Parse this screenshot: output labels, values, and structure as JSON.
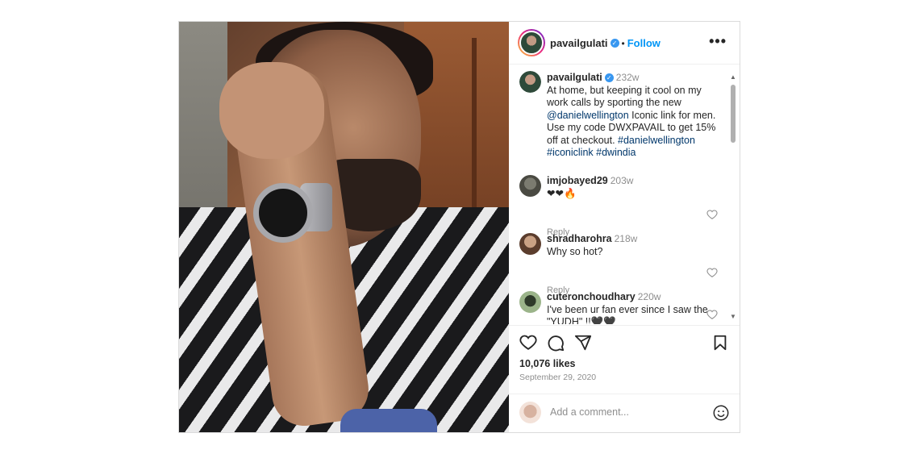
{
  "post": {
    "author": "pavailgulati",
    "follow_label": "Follow",
    "dot": "•",
    "more_label": "•••"
  },
  "caption": {
    "username": "pavailgulati",
    "time": "232w",
    "text_before": "At home, but keeping it cool on my work calls by sporting the new ",
    "mention": "@danielwellington",
    "text_after": " Iconic link for men. Use my code DWXPAVAIL to get 15% off at checkout. ",
    "hashtags": "#danielwellington #iconiclink #dwindia"
  },
  "comments": [
    {
      "username": "imjobayed29",
      "time": "203w",
      "text": "❤❤🔥",
      "reply": "Reply"
    },
    {
      "username": "shradharohra",
      "time": "218w",
      "text": "Why so hot?",
      "reply": "Reply"
    },
    {
      "username": "cuteronchoudhary",
      "time": "220w",
      "text": "I've been ur fan ever since I saw the \"YUDH\" !!🖤🖤"
    }
  ],
  "stats": {
    "likes": "10,076 likes",
    "date": "September 29, 2020"
  },
  "composer": {
    "placeholder": "Add a comment..."
  },
  "icons": {
    "verified": "verified-badge-icon",
    "like": "heart-icon",
    "comment": "comment-icon",
    "share": "share-icon",
    "save": "bookmark-icon",
    "emoji": "emoji-icon"
  },
  "colors": {
    "link": "#00376b",
    "follow": "#0095f6",
    "verified": "#3897f0",
    "muted": "#8e8e8e"
  }
}
